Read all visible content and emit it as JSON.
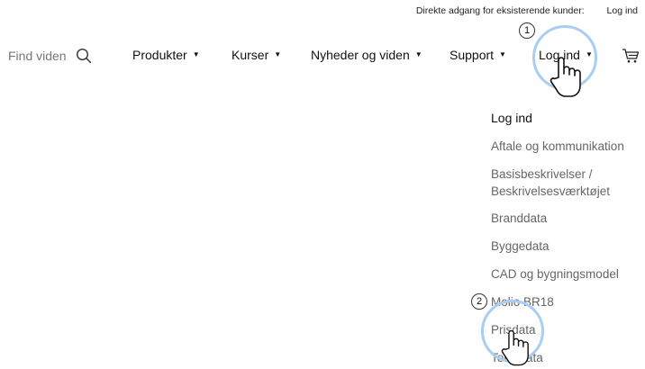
{
  "topbar": {
    "prompt": "Direkte adgang for eksisterende kunder:",
    "login_link": "Log ind"
  },
  "search": {
    "placeholder": "Find viden",
    "icon": "search-icon"
  },
  "nav": {
    "items": [
      {
        "label": "Produkter",
        "caret": "▼"
      },
      {
        "label": "Kurser",
        "caret": "▼"
      },
      {
        "label": "Nyheder og viden",
        "caret": "▼"
      },
      {
        "label": "Support",
        "caret": "▼"
      },
      {
        "label": "Log ind",
        "caret": "▼"
      }
    ],
    "cart_icon": "cart-icon"
  },
  "annotations": {
    "step1": "1",
    "step2": "2",
    "highlight_color": "#a9cdf3"
  },
  "dropdown": {
    "heading": "Log ind",
    "items": [
      "Aftale og kommunikation",
      "Basisbeskrivelser /",
      "Beskrivelsesværktøjet",
      "Branddata",
      "Byggedata",
      "CAD og bygningsmodel",
      "Molio BR18",
      "Prisdata",
      "Tekstdata"
    ]
  }
}
